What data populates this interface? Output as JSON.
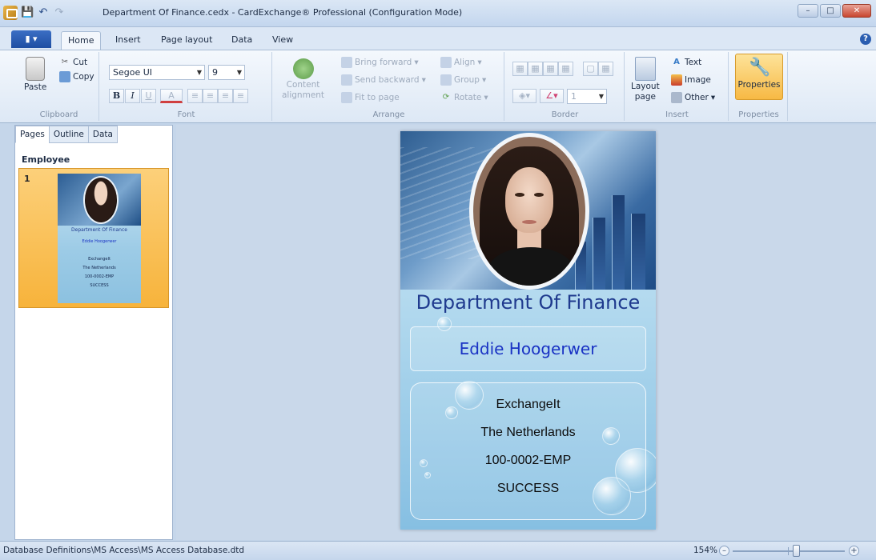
{
  "window": {
    "title": "Department Of Finance.cedx - CardExchange® Professional (Configuration Mode)",
    "controls": {
      "minimize": "–",
      "maximize": "□",
      "close": "✕"
    }
  },
  "quick_access": {
    "save": "💾",
    "undo": "↶",
    "redo": "↷"
  },
  "ribbon_tabs": [
    "Home",
    "Insert",
    "Page layout",
    "Data",
    "View"
  ],
  "active_tab": "Home",
  "ribbon": {
    "clipboard": {
      "paste": "Paste",
      "cut": "Cut",
      "copy": "Copy",
      "label": "Clipboard"
    },
    "font": {
      "family": "Segoe UI",
      "size": "9",
      "bold": "B",
      "italic": "I",
      "underline": "U",
      "color": "A",
      "label": "Font"
    },
    "arrange": {
      "content_alignment_1": "Content",
      "content_alignment_2": "alignment",
      "bring_forward": "Bring forward",
      "send_backward": "Send backward",
      "fit_to_page": "Fit to page",
      "align": "Align",
      "group": "Group",
      "rotate": "Rotate",
      "label": "Arrange"
    },
    "border": {
      "width_value": "1",
      "label": "Border"
    },
    "insert": {
      "layout_page_1": "Layout",
      "layout_page_2": "page",
      "text": "Text",
      "image": "Image",
      "other": "Other",
      "label": "Insert"
    },
    "properties": {
      "button": "Properties",
      "label": "Properties"
    }
  },
  "left_pane": {
    "tabs": [
      "Pages",
      "Outline",
      "Data"
    ],
    "active_tab": "Pages",
    "section": "Employee",
    "pages": [
      {
        "number": "1",
        "thumb_lines": [
          "Department Of Finance",
          "Eddie Hoogerwer",
          "ExchangeIt",
          "The Netherlands",
          "100-0002-EMP",
          "SUCCESS"
        ]
      }
    ]
  },
  "card": {
    "department": "Department Of Finance",
    "name": "Eddie Hoogerwer",
    "company": "ExchangeIt",
    "country": "The Netherlands",
    "employee_id": "100-0002-EMP",
    "status": "SUCCESS"
  },
  "statusbar": {
    "path": "Database Definitions\\MS Access\\MS Access Database.dtd",
    "zoom": "154%",
    "zoom_minus": "–",
    "zoom_plus": "+"
  },
  "colors": {
    "accent_tab": "#2a5db0",
    "selected_page": "#f7b33b",
    "department_text": "#1f3a8e",
    "name_text": "#1a33c4"
  }
}
